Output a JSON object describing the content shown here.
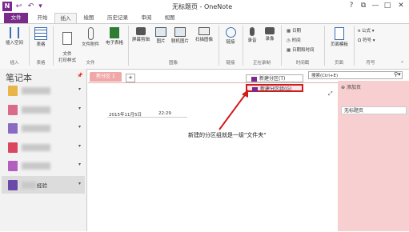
{
  "app": {
    "title": "无标题页 - OneNote",
    "logo": "N"
  },
  "quick_access": [
    "back-icon",
    "undo-icon",
    "dropdown-icon"
  ],
  "window_controls": {
    "help": "?",
    "restore": "⧉",
    "minimize": "—",
    "maximize": "□",
    "close": "✕"
  },
  "tabs": [
    "文件",
    "开始",
    "插入",
    "绘图",
    "历史记录",
    "审阅",
    "视图"
  ],
  "ribbon": {
    "insert_space": "插入空间",
    "table": "表格",
    "file_printout": "文件\n打印样式",
    "file_attach": "文件附件",
    "spreadsheet": "电子表格",
    "screen_clip": "屏幕剪辑",
    "picture": "图片",
    "online_picture": "联机图片",
    "scanned_image": "扫描图像",
    "link": "链接",
    "record_audio": "录音",
    "record_video": "录像",
    "date": "日期",
    "time": "时间",
    "date_time": "日期和时间",
    "page_template": "页面模板",
    "equation": "π 公式",
    "symbol": "Ω 符号",
    "groups": [
      "插入",
      "表格",
      "文件",
      "图像",
      "链接",
      "正在录制",
      "时间戳",
      "页面",
      "符号"
    ]
  },
  "nav": {
    "title": "笔记本",
    "last_item": "经验",
    "pin": "📌"
  },
  "section_tab": "新分区 1",
  "add_tab": "+",
  "search": {
    "placeholder": "搜索(Ctrl+E)"
  },
  "menu": {
    "new_section": "新建分区(T)",
    "new_section_group": "新建分区组(G)"
  },
  "right_panel": {
    "add_page": "添加页",
    "untitled_page": "无标题页"
  },
  "page": {
    "date": "2015年11月5日",
    "time": "22:29"
  },
  "annotation": "新建的分区组就是一级\"文件夹\"",
  "colors": {
    "accent": "#7a2a8a",
    "section_tab": "#f0a7a7",
    "right_panel": "#f8cfd1",
    "annotation_border": "#d21c1c",
    "nb_yellow": "#e7b54a",
    "nb_pink": "#d96a8a",
    "nb_purple": "#8a6bc4",
    "nb_red": "#d9485f",
    "nb_violet": "#b35fc0",
    "nb_indigo": "#6a4aa8"
  }
}
